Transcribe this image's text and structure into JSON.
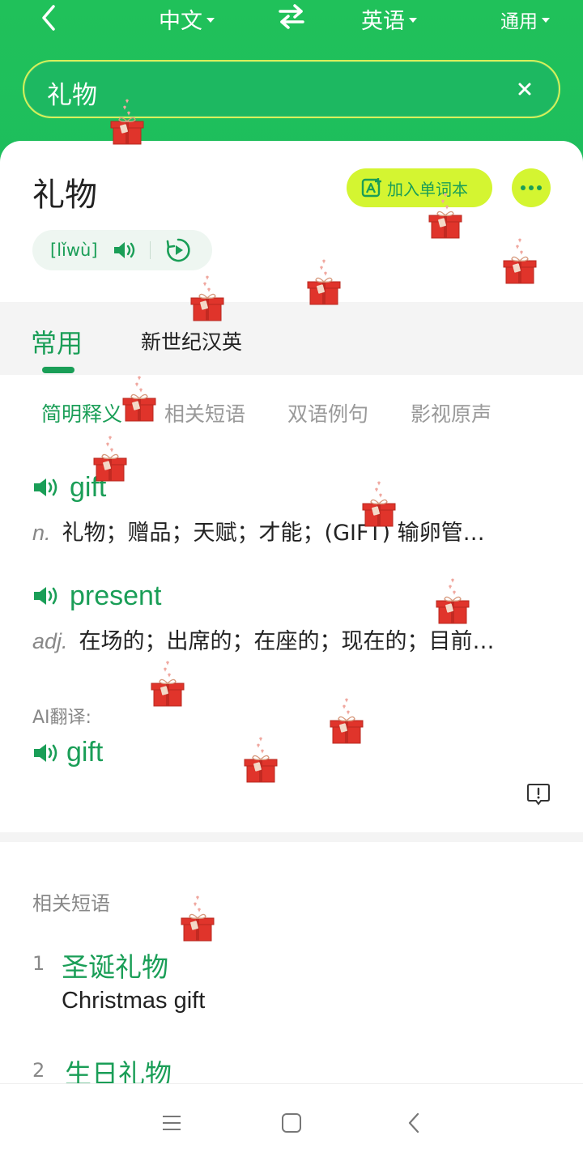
{
  "header": {
    "source_lang": "中文",
    "target_lang": "英语",
    "mode": "通用"
  },
  "search": {
    "value": "礼物"
  },
  "card": {
    "headword": "礼物",
    "add_to_wordbook": "加入单词本",
    "pinyin": "[lǐwù]"
  },
  "dict_tabs": [
    {
      "label": "常用",
      "active": true
    },
    {
      "label": "新世纪汉英",
      "active": false
    }
  ],
  "subtabs": [
    {
      "label": "简明释义",
      "active": true
    },
    {
      "label": "相关短语",
      "active": false
    },
    {
      "label": "双语例句",
      "active": false
    },
    {
      "label": "影视原声",
      "active": false
    }
  ],
  "entries": [
    {
      "word": "gift",
      "pos": "n.",
      "definition": "礼物；赠品；天赋；才能；(GIFT) 输卵管…"
    },
    {
      "word": "present",
      "pos": "adj.",
      "definition": "在场的；出席的；在座的；现在的；目前…"
    }
  ],
  "ai": {
    "label": "AI翻译:",
    "word": "gift"
  },
  "phrases": {
    "title": "相关短语",
    "items": [
      {
        "num": "1",
        "zh": "圣诞礼物",
        "en": "Christmas gift"
      },
      {
        "num": "2",
        "zh": "生日礼物",
        "en": ""
      }
    ]
  },
  "colors": {
    "brand_green": "#1ebe5d",
    "accent_green": "#1a9e57",
    "highlight_yellow": "#d4f531",
    "gift_red": "#e0342b"
  }
}
